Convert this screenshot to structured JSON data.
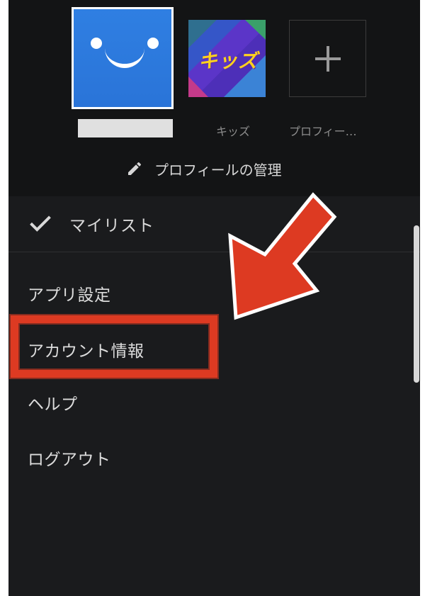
{
  "profiles": [
    {
      "name": ""
    },
    {
      "name": "キッズ",
      "avatar_text": "キッズ"
    },
    {
      "name": "プロフィー…"
    }
  ],
  "manage_profiles_label": "プロフィールの管理",
  "my_list_label": "マイリスト",
  "menu_items": [
    {
      "label": "アプリ設定"
    },
    {
      "label": "アカウント情報"
    },
    {
      "label": "ヘルプ"
    },
    {
      "label": "ログアウト"
    }
  ],
  "annotation": {
    "highlighted_item": "アカウント情報",
    "color": "#dd3a22"
  },
  "colors": {
    "panel_background": "#1a1b1d",
    "profiles_background": "#131415",
    "main_avatar_blue": "#2a74d8"
  },
  "icons": {
    "main_avatar": "smiley-face-icon",
    "add_profile": "plus-icon",
    "manage": "pencil-icon",
    "my_list": "check-icon"
  }
}
